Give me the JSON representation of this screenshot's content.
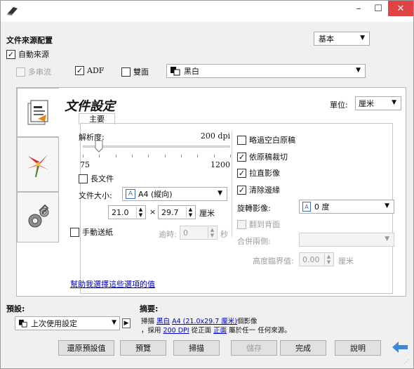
{
  "titlebar": {
    "minimize": "–",
    "maximize": "☐",
    "close": "✕"
  },
  "source": {
    "heading": "文件來源配置",
    "mode_value": "基本",
    "auto_source_label": "自動來源",
    "multi_stream_label": "多串流",
    "adf_label": "ADF",
    "duplex_label": "雙面",
    "color_mode_value": "黑白"
  },
  "document": {
    "title": "文件設定",
    "unit_label": "單位:",
    "unit_value": "厘米",
    "subtab_main": "主要",
    "resolution_label": "解析度:",
    "resolution_value": "200 dpi",
    "slider_min": "75",
    "slider_max": "1200",
    "long_doc_label": "長文件",
    "paper_size_label": "文件大小:",
    "paper_size_value": "A4 (縱向)",
    "width_value": "21.0",
    "times_sign": "×",
    "height_value": "29.7",
    "dimension_unit": "厘米",
    "manual_feed_label": "手動送紙",
    "timeout_label": "逾時:",
    "timeout_value": "0",
    "timeout_unit": "秒",
    "skip_blank_label": "略過空白原稿",
    "crop_label": "依原稿裁切",
    "straighten_label": "拉直影像",
    "edge_clean_label": "清除邊緣",
    "rotate_label": "旋轉影像:",
    "rotate_value": "0 度",
    "flip_back_label": "翻到背面",
    "merge_label": "合併兩側:",
    "merge_value": "",
    "height_threshold_label": "高度臨界值:",
    "height_threshold_value": "0.00",
    "height_threshold_unit": "厘米",
    "help_link": "幫助我選擇這些選項的值"
  },
  "preset": {
    "label": "預設:",
    "value": "上次使用設定"
  },
  "summary": {
    "label": "摘要:",
    "line1_prefix": "掃描",
    "line1_color": "黑白",
    "line1_size": "A4 (21.0x29.7 厘米)",
    "line1_suffix": "個影像",
    "line2_prefix": "，採用",
    "line2_dpi": "200 DPI",
    "line2_mid": "從正面",
    "line2_side": "正面",
    "line2_suffix": "屬於任一 任何來源。"
  },
  "buttons": {
    "reset": "還原預設值",
    "preview": "預覽",
    "scan": "掃描",
    "save": "儲存",
    "done": "完成",
    "help": "說明"
  },
  "slider": {
    "level": 0.11
  },
  "colors": {
    "close_button": "#e04343",
    "link": "#0000cc",
    "back_arrow": "#3b8ad9"
  }
}
